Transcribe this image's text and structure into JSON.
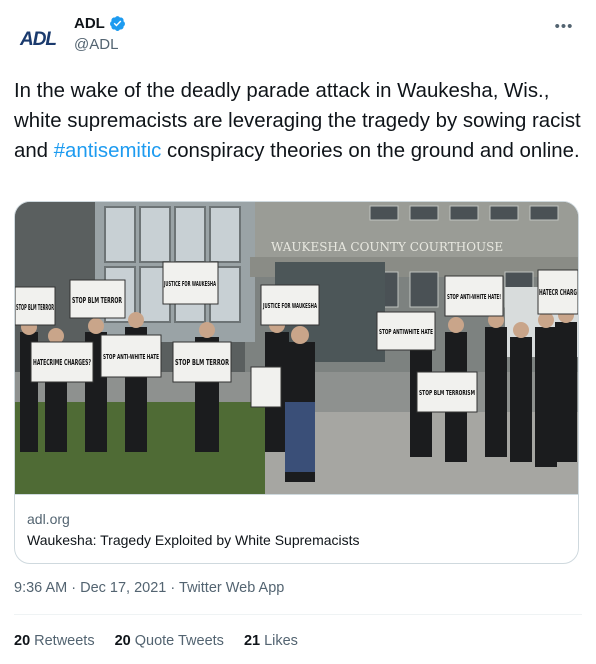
{
  "author": {
    "display_name": "ADL",
    "handle": "@ADL",
    "logo_text": "ADL",
    "verified": true
  },
  "tweet": {
    "text_before": "In the wake of the deadly parade attack in Waukesha, Wis., white supremacists are leveraging the tragedy by sowing racist and ",
    "hashtag": "#antisemitic",
    "text_after": " conspiracy theories on the ground and online."
  },
  "card": {
    "domain": "adl.org",
    "title": "Waukesha: Tragedy Exploited by White Supremacists",
    "image_signs": {
      "building": "WAUKESHA COUNTY COURTHOUSE",
      "sign_stop_blm_terror_left": "STOP BLM TERROR",
      "sign_justice_1": "JUSTICE FOR WAUKESHA",
      "sign_justice_2": "JUSTICE FOR WAUKESHA",
      "sign_hatecrime": "HATECRIME CHARGES?",
      "sign_stop_anti_white_1": "STOP ANTI-WHITE HATE",
      "sign_stop_blm_terror_2": "STOP BLM TERROR",
      "sign_stop_anti_white_2": "STOP ANTIWHITE HATE",
      "sign_stop_anti_white_3": "STOP ANTI-WHITE HATE!",
      "sign_hatecrime_right": "HATECR CHARG",
      "sign_stop_blm_terrorism": "STOP BLM TERRORISM"
    }
  },
  "meta": {
    "time": "9:36 AM",
    "separator": "·",
    "date": "Dec 17, 2021",
    "source": "Twitter Web App"
  },
  "stats": {
    "retweets_count": "20",
    "retweets_label": "Retweets",
    "quotes_count": "20",
    "quotes_label": "Quote Tweets",
    "likes_count": "21",
    "likes_label": "Likes"
  },
  "colors": {
    "accent": "#1d9bf0",
    "text": "#0f1419",
    "muted": "#536471",
    "border": "#cfd9de"
  }
}
